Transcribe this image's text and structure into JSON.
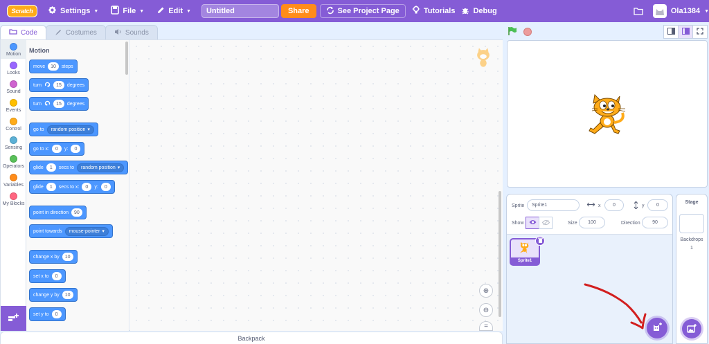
{
  "app": {
    "logo_text": "Scratch",
    "brand_color": "#855cd6",
    "accent_color": "#ff8c1a"
  },
  "menubar": {
    "settings": "Settings",
    "file": "File",
    "edit": "Edit",
    "project_title": "Untitled",
    "share": "Share",
    "see_project_page": "See Project Page",
    "tutorials": "Tutorials",
    "debug": "Debug",
    "username": "Ola1384"
  },
  "tabs": {
    "code": "Code",
    "costumes": "Costumes",
    "sounds": "Sounds"
  },
  "categories": [
    {
      "label": "Motion",
      "color": "#4c97ff"
    },
    {
      "label": "Looks",
      "color": "#9966ff"
    },
    {
      "label": "Sound",
      "color": "#cf63cf"
    },
    {
      "label": "Events",
      "color": "#ffbf00"
    },
    {
      "label": "Control",
      "color": "#ffab19"
    },
    {
      "label": "Sensing",
      "color": "#5cb1d6"
    },
    {
      "label": "Operators",
      "color": "#59c059"
    },
    {
      "label": "Variables",
      "color": "#ff8c1a"
    },
    {
      "label": "My Blocks",
      "color": "#ff6680"
    }
  ],
  "palette": {
    "title": "Motion",
    "blocks": {
      "move": {
        "a": "move",
        "v": "10",
        "b": "steps"
      },
      "turn_right": {
        "a": "turn",
        "v": "15",
        "b": "degrees"
      },
      "turn_left": {
        "a": "turn",
        "v": "15",
        "b": "degrees"
      },
      "goto": {
        "a": "go to",
        "d": "random position"
      },
      "gotoxy": {
        "a": "go to x:",
        "x": "0",
        "b": "y:",
        "y": "0"
      },
      "glide_to": {
        "a": "glide",
        "v": "1",
        "b": "secs to",
        "d": "random position"
      },
      "glide_xy": {
        "a": "glide",
        "v": "1",
        "b": "secs to x:",
        "x": "0",
        "c": "y:",
        "y": "0"
      },
      "point_dir": {
        "a": "point in direction",
        "v": "90"
      },
      "point_towards": {
        "a": "point towards",
        "d": "mouse-pointer"
      },
      "change_x": {
        "a": "change x by",
        "v": "10"
      },
      "set_x": {
        "a": "set x to",
        "v": "0"
      },
      "change_y": {
        "a": "change y by",
        "v": "10"
      },
      "set_y": {
        "a": "set y to",
        "v": "0"
      }
    }
  },
  "backpack": "Backpack",
  "sprite_info": {
    "sprite_label": "Sprite",
    "sprite_name": "Sprite1",
    "x_label": "x",
    "x": "0",
    "y_label": "y",
    "y": "0",
    "show_label": "Show",
    "size_label": "Size",
    "size": "100",
    "direction_label": "Direction",
    "direction": "90"
  },
  "sprites": [
    {
      "name": "Sprite1"
    }
  ],
  "stage_pane": {
    "label": "Stage",
    "backdrops_label": "Backdrops",
    "backdrops_count": "1"
  }
}
